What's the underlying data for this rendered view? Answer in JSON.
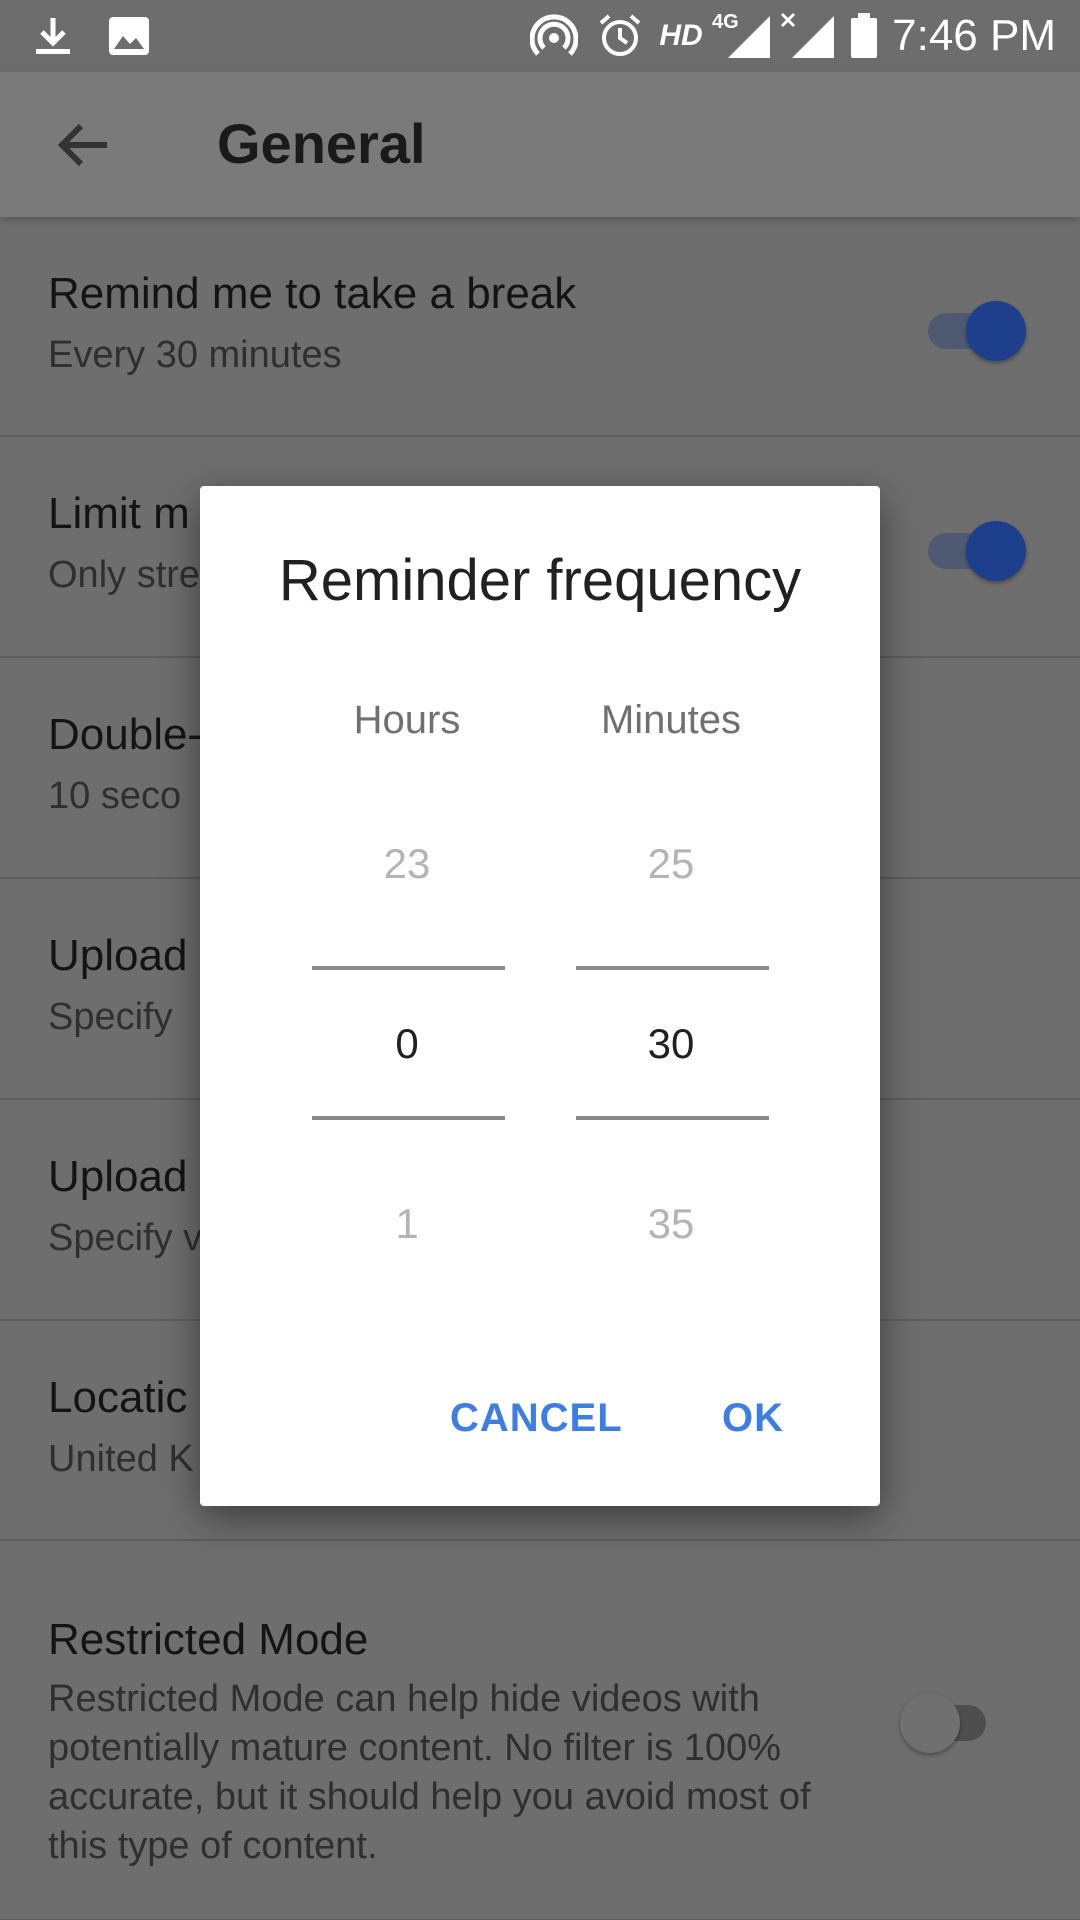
{
  "status_bar": {
    "time": "7:46 PM",
    "network_label": "4G",
    "hd_label": "HD",
    "icons": [
      "download-icon",
      "image-icon",
      "hotspot-icon",
      "alarm-icon",
      "hd-icon",
      "signal-icon",
      "signal-no-data-icon",
      "battery-icon"
    ]
  },
  "app_bar": {
    "title": "General",
    "back_icon": "arrow-back-icon"
  },
  "settings": {
    "items": [
      {
        "title": "Remind me to take a break",
        "subtitle": "Every 30 minutes",
        "toggle": "on"
      },
      {
        "title": "Limit m",
        "subtitle": "Only stre",
        "toggle": "on"
      },
      {
        "title": "Double-",
        "subtitle": "10 seco"
      },
      {
        "title": "Upload",
        "subtitle": "Specify"
      },
      {
        "title": "Upload",
        "subtitle": "Specify v"
      },
      {
        "title": "Locatic",
        "subtitle": "United K"
      },
      {
        "title": "Restricted Mode",
        "description": "Restricted Mode can help hide videos with potentially mature content. No filter is 100% accurate, but it should help you avoid most of this type of content.",
        "toggle": "off"
      }
    ]
  },
  "dialog": {
    "title": "Reminder frequency",
    "hours": {
      "label": "Hours",
      "prev": "23",
      "selected": "0",
      "next": "1"
    },
    "minutes": {
      "label": "Minutes",
      "prev": "25",
      "selected": "30",
      "next": "35"
    },
    "cancel_label": "CANCEL",
    "ok_label": "OK"
  },
  "colors": {
    "accent": "#3d7ee0",
    "toggle_on": "#1e3f8c",
    "scrim": "#6e6e6e"
  }
}
